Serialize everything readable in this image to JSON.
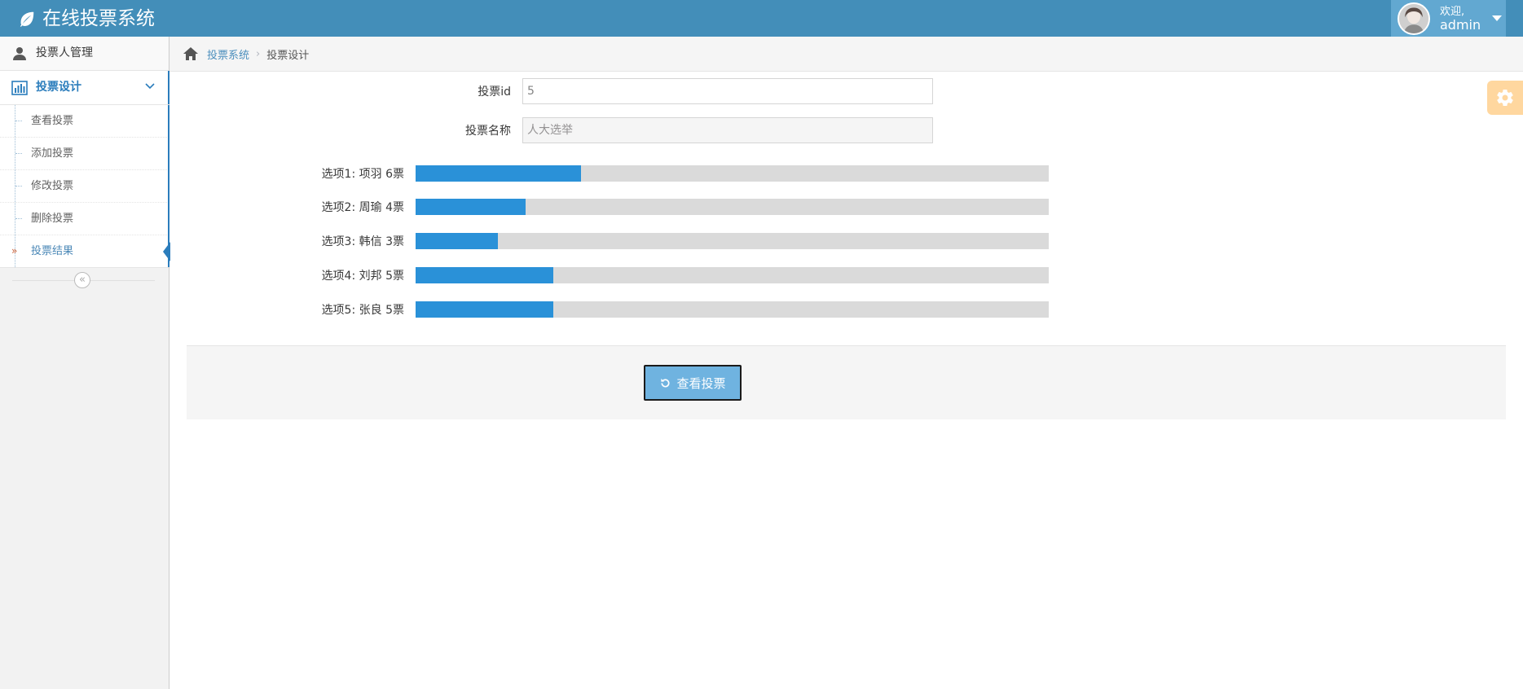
{
  "navbar": {
    "brand": "在线投票系统",
    "welcome": "欢迎,",
    "username": "admin"
  },
  "sidebar": {
    "items": [
      {
        "label": "投票人管理",
        "icon": "user-icon"
      },
      {
        "label": "投票设计",
        "icon": "bar-chart-icon",
        "expanded": true
      }
    ],
    "submenu": [
      {
        "label": "查看投票"
      },
      {
        "label": "添加投票"
      },
      {
        "label": "修改投票"
      },
      {
        "label": "删除投票"
      },
      {
        "label": "投票结果",
        "active": true
      }
    ],
    "collapse_glyph": "«"
  },
  "breadcrumbs": {
    "root": "投票系统",
    "separator": "›",
    "current": "投票设计"
  },
  "form": {
    "id_label": "投票id",
    "id_value": "5",
    "name_label": "投票名称",
    "name_placeholder": "人大选举"
  },
  "chart_data": {
    "type": "bar",
    "orientation": "horizontal",
    "categories": [
      "选项1: 项羽 6票",
      "选项2: 周瑜 4票",
      "选项3: 韩信 3票",
      "选项4: 刘邦 5票",
      "选项5: 张良 5票"
    ],
    "values": [
      6,
      4,
      3,
      5,
      5
    ],
    "xlim": [
      0,
      23
    ],
    "bar_color": "#2a91d8",
    "track_color": "#dadada"
  },
  "actions": {
    "view_label": "查看投票"
  },
  "colors": {
    "navbar": "#438eb9",
    "accent": "#2b7dbc",
    "settings": "#ffb752"
  }
}
